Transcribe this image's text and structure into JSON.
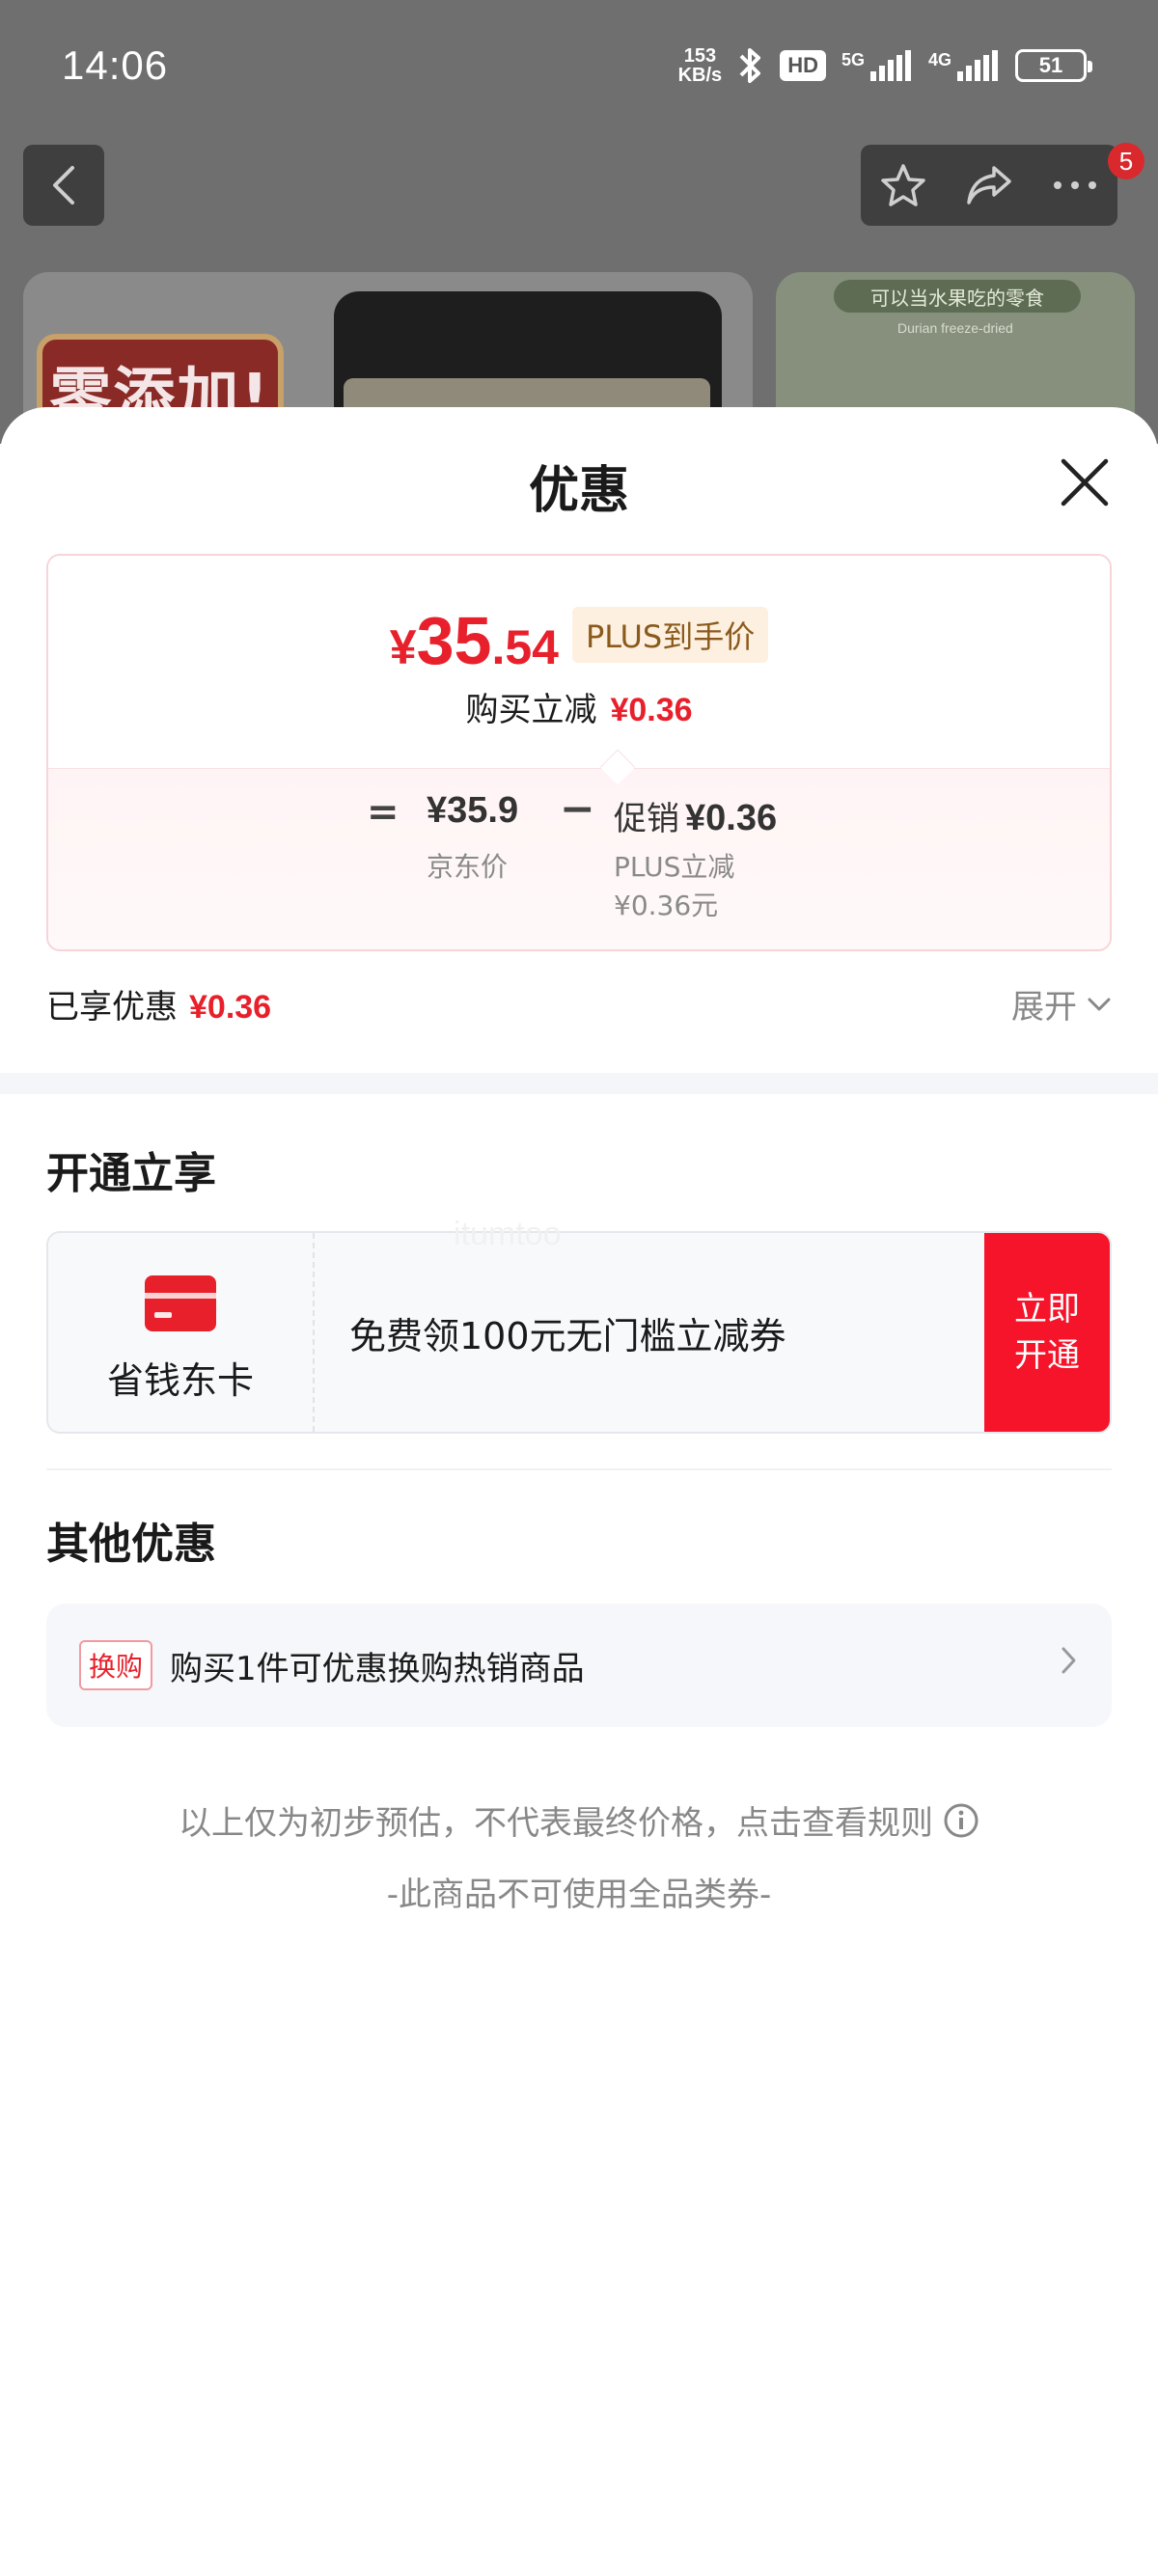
{
  "status_bar": {
    "time": "14:06",
    "net_speed_value": "153",
    "net_speed_unit": "KB/s",
    "hd_label": "HD",
    "signal_5g": "5G",
    "signal_4g": "4G",
    "battery": "51"
  },
  "background_page": {
    "notification_count": "5",
    "product_tag": "零添加!",
    "card2_tag": "可以当水果吃的零食",
    "card2_sub": "Durian freeze-dried"
  },
  "sheet": {
    "title": "优惠",
    "price_summary": {
      "currency": "¥",
      "final_int": "35",
      "final_dec": ".54",
      "plus_tag": "PLUS到手价",
      "reduce_label": "购买立减",
      "reduce_value": "¥0.36",
      "equals": "=",
      "jd_price": "¥35.9",
      "jd_label": "京东价",
      "minus": "−",
      "promo_label": "促销",
      "promo_value": "¥0.36",
      "promo_sub1": "PLUS立减",
      "promo_sub2": "¥0.36元"
    },
    "enjoyed": {
      "label": "已享优惠",
      "value": "¥0.36",
      "expand_label": "展开"
    },
    "section_open": {
      "title": "开通立享",
      "card_name": "省钱东卡",
      "card_desc": "免费领100元无门槛立减券",
      "open_btn_line1": "立即",
      "open_btn_line2": "开通",
      "watermark": "itumtoo"
    },
    "section_other": {
      "title": "其他优惠",
      "tag": "换购",
      "text": "购买1件可优惠换购热销商品"
    },
    "disclaimer": "以上仅为初步预估，不代表最终价格，点击查看规则",
    "no_coupon": "-此商品不可使用全品类券-"
  },
  "colors": {
    "accent_red": "#e8202b",
    "open_btn_red": "#f5142a",
    "plus_tag_bg": "#fdf0e0",
    "plus_tag_text": "#8a5a1c"
  }
}
